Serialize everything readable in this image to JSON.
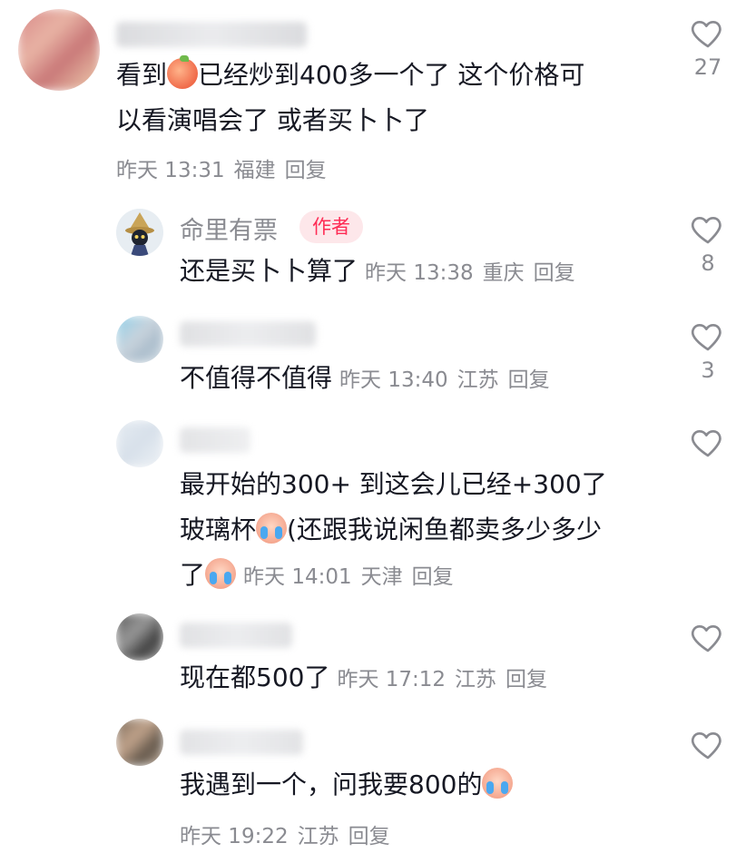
{
  "comments": [
    {
      "text_parts": [
        "看到",
        "已经炒到400多一个了 这个价格可",
        "以看演唱会了 或者买卜卜了"
      ],
      "emoji_1": "peach-emoji",
      "time": "昨天 13:31",
      "location": "福建",
      "reply_label": "回复",
      "likes": "27"
    },
    {
      "username": "命里有票",
      "badge": "作者",
      "text": "还是买卜卜算了",
      "time": "昨天 13:38",
      "location": "重庆",
      "reply_label": "回复",
      "likes": "8"
    },
    {
      "text": "不值得不值得",
      "time": "昨天 13:40",
      "location": "江苏",
      "reply_label": "回复",
      "likes": "3"
    },
    {
      "line1": "最开始的300+ 到这会儿已经+300了",
      "line2_a": "玻璃杯",
      "line2_b": "(还跟我说闲鱼都卖多少多少",
      "line3": "了",
      "emoji": "crying-face-emoji",
      "time": "昨天 14:01",
      "location": "天津",
      "reply_label": "回复",
      "likes": ""
    },
    {
      "text": "现在都500了",
      "time": "昨天 17:12",
      "location": "江苏",
      "reply_label": "回复",
      "likes": ""
    },
    {
      "text": "我遇到一个，问我要800的",
      "emoji": "crying-face-emoji",
      "time": "昨天 19:22",
      "location": "江苏",
      "reply_label": "回复",
      "likes": ""
    }
  ],
  "colors": {
    "text": "#161823",
    "secondary": "#8a8b91",
    "author_badge_bg": "#fde7ea",
    "author_badge_text": "#fe2c55"
  },
  "icons": {
    "like": "heart-outline-icon"
  }
}
